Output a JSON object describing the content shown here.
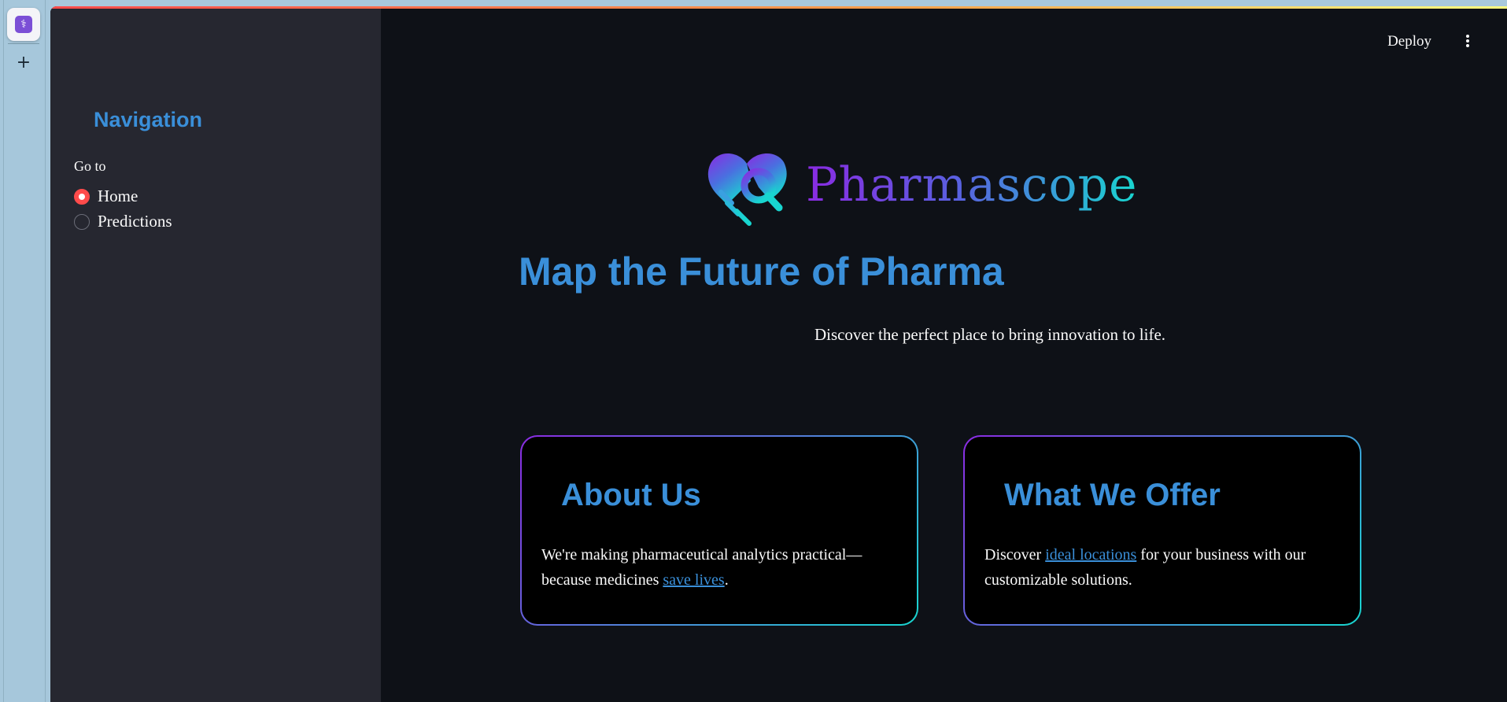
{
  "sidebar": {
    "title": "Navigation",
    "goto_label": "Go to",
    "options": [
      {
        "label": "Home",
        "selected": true
      },
      {
        "label": "Predictions",
        "selected": false
      }
    ]
  },
  "header": {
    "deploy_label": "Deploy",
    "menu_icon": "kebab-menu-icon"
  },
  "brand": {
    "name": "Pharmascope",
    "logo_icon": "heart-magnifier-logo"
  },
  "hero": {
    "title": "Map the Future of Pharma",
    "tagline": "Discover the perfect place to bring innovation to life."
  },
  "cards": [
    {
      "title": "About Us",
      "text_before": "We're making pharmaceutical analytics practical—because medicines ",
      "link": "save lives",
      "text_after": "."
    },
    {
      "title": "What We Offer",
      "text_before": "Discover ",
      "link": "ideal locations",
      "text_after": " for your business with our customizable solutions."
    }
  ],
  "colors": {
    "accent_blue": "#3a8fd9",
    "radio_selected": "#ff4b4b",
    "gradient_start": "#8a2be2",
    "gradient_end": "#18d6d0",
    "background": "#0e1117",
    "sidebar_bg": "#262730"
  }
}
